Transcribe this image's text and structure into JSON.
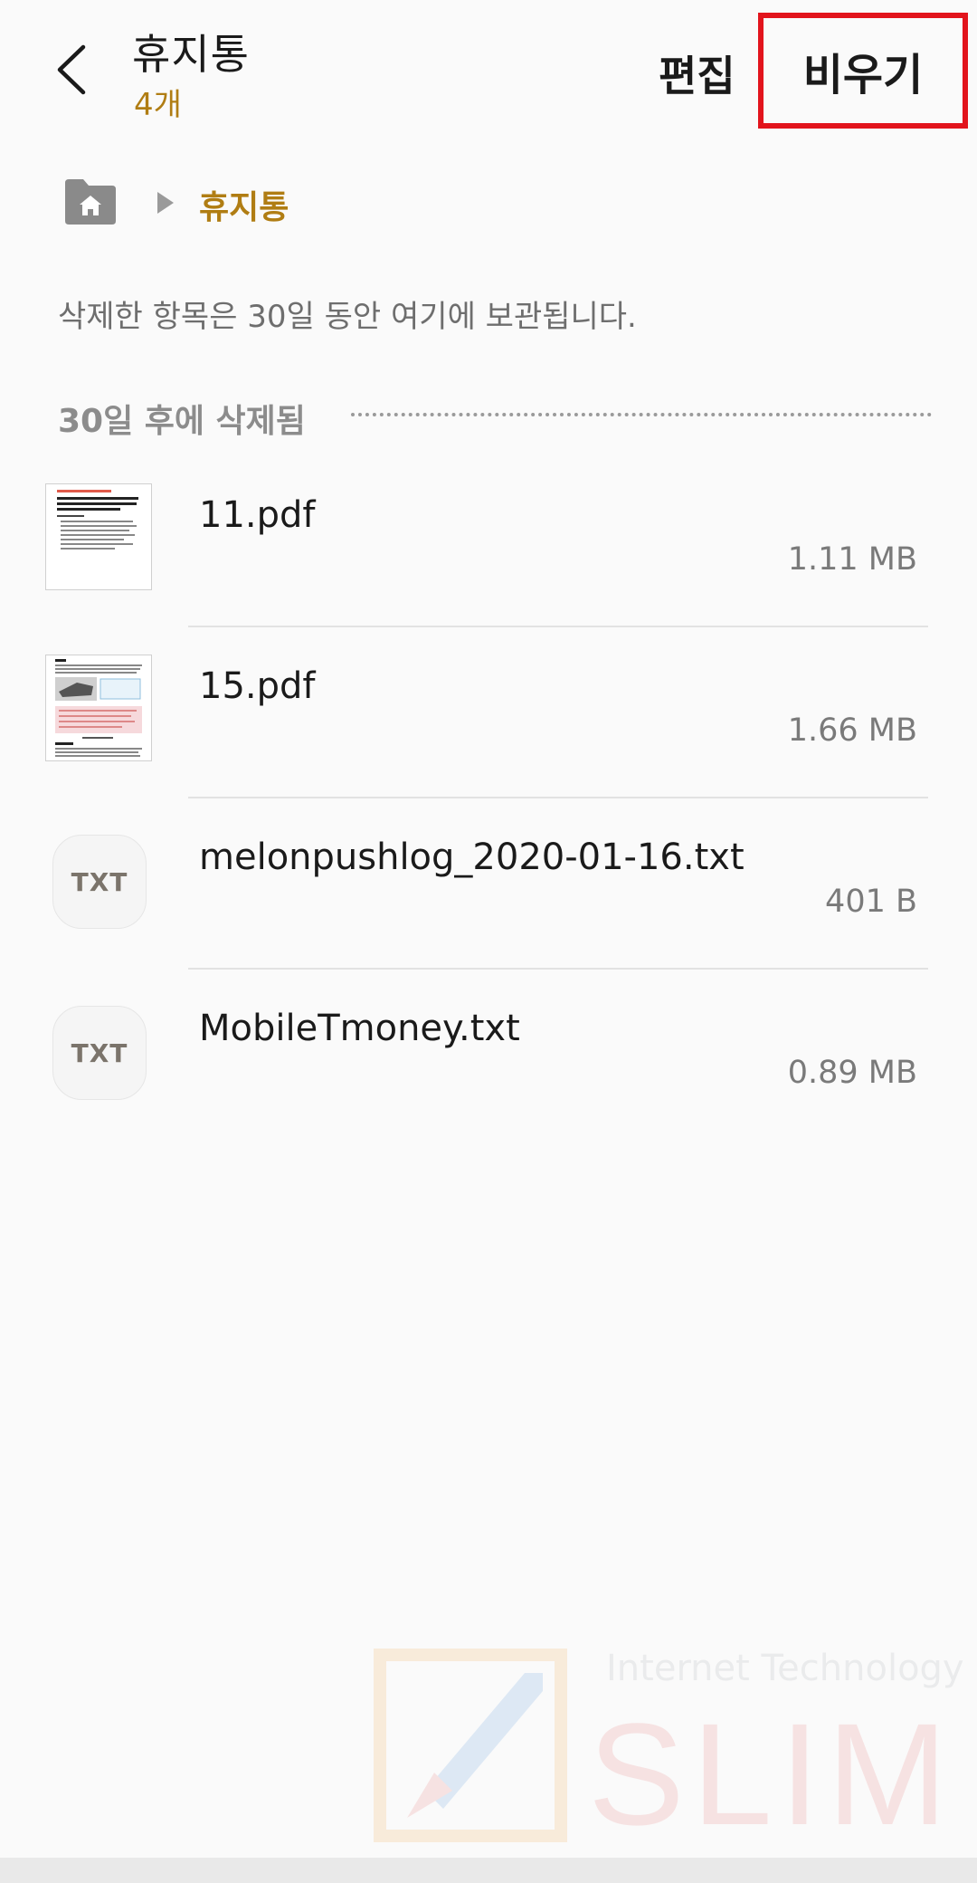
{
  "header": {
    "title": "휴지통",
    "count": "4개",
    "edit_label": "편집",
    "empty_label": "비우기"
  },
  "breadcrumb": {
    "current": "휴지통"
  },
  "info_text": "삭제한 항목은 30일 동안 여기에 보관됩니다.",
  "section": {
    "label": "30일 후에 삭제됨"
  },
  "files": [
    {
      "name": "11.pdf",
      "size": "1.11 MB",
      "type": "pdf"
    },
    {
      "name": "15.pdf",
      "size": "1.66 MB",
      "type": "pdf"
    },
    {
      "name": "melonpushlog_2020-01-16.txt",
      "size": "401 B",
      "type": "txt",
      "icon_label": "TXT"
    },
    {
      "name": "MobileTmoney.txt",
      "size": "0.89 MB",
      "type": "txt",
      "icon_label": "TXT"
    }
  ],
  "watermark": {
    "top": "Internet Technology",
    "big": "SLIM"
  },
  "colors": {
    "accent": "#b07d13",
    "highlight_box": "#e2141c",
    "background": "#fafafa"
  }
}
